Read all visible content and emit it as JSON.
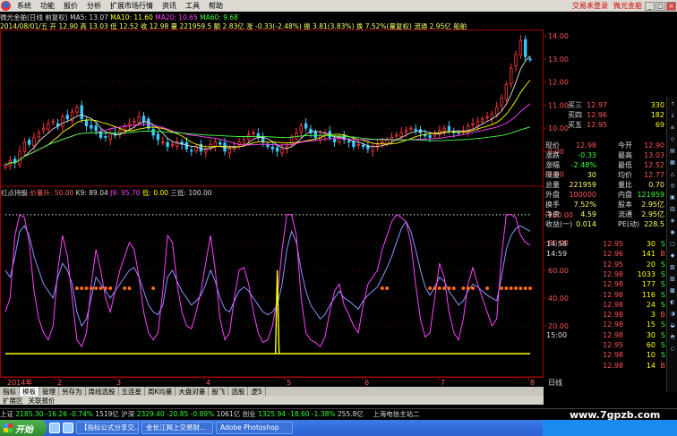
{
  "menu": {
    "items": [
      "系统",
      "功能",
      "报价",
      "分析",
      "扩展市场行情",
      "资讯",
      "工具",
      "帮助"
    ],
    "login_status": "交易未登录",
    "stock_name": "微光金舶"
  },
  "info": {
    "ma_line": [
      "微光金舶(日线 前复权)",
      "MA5: 13.07",
      "MA10: 11.60",
      "MA20: 10.65",
      "MA60: 9.68"
    ],
    "ma_colors": [
      "#dddddd",
      "#ffff00",
      "#ff44ff",
      "#44ff44"
    ],
    "day_line": "2014/08/01/五 开 12.90 高 13.03 低 12.52 收 12.98 量 221959.5 额 2.83亿 涨 -0.33(-2.48%) 振 3.81(3.83%) 换 7.52%(量复权) 流通 2.95亿 船舶"
  },
  "indicator": {
    "title": "红点持股",
    "values": [
      "价量升: 50.00",
      "K9: 89.04",
      "J9: 95.70",
      "低: 0.00",
      "三低: 100.00"
    ],
    "colors": [
      "#ff6666",
      "#dddddd",
      "#ff44ff",
      "#ffff00",
      "#dddddd"
    ]
  },
  "axis": {
    "price_ticks": [
      "14.00",
      "13.00",
      "12.00",
      "11.00",
      "10.00",
      "9.00",
      "8.00"
    ],
    "ind_ticks": [
      "100.00",
      "80.00",
      "60.00",
      "40.00",
      "20.00"
    ],
    "x_labels": [
      "2014年",
      "2",
      "3",
      "4",
      "5",
      "6",
      "7",
      "8"
    ],
    "x_right": "日线"
  },
  "chart_data": {
    "type": "candlestick",
    "ylim": [
      7.6,
      14.2
    ],
    "closes": [
      8.4,
      8.6,
      8.5,
      9.0,
      9.4,
      9.3,
      9.6,
      9.8,
      10.0,
      10.2,
      10.3,
      10.1,
      10.5,
      10.4,
      10.7,
      10.9,
      10.4,
      10.1,
      10.0,
      9.9,
      9.6,
      9.6,
      9.8,
      9.7,
      9.9,
      10.1,
      10.2,
      10.3,
      10.5,
      10.3,
      10.0,
      9.7,
      9.5,
      9.4,
      9.2,
      9.3,
      9.4,
      9.3,
      9.1,
      9.0,
      9.2,
      9.0,
      9.1,
      9.3,
      9.4,
      9.3,
      9.0,
      9.1,
      9.2,
      9.4,
      9.5,
      9.7,
      9.8,
      9.6,
      9.4,
      9.2,
      9.1,
      9.0,
      9.1,
      9.2,
      9.6,
      9.8,
      10.1,
      10.0,
      9.8,
      9.6,
      9.7,
      9.8,
      9.6,
      9.4,
      9.6,
      9.5,
      9.4,
      9.2,
      9.3,
      9.2,
      9.1,
      9.2,
      9.3,
      9.4,
      9.5,
      9.6,
      9.7,
      9.8,
      9.9,
      10.0,
      9.9,
      9.8,
      9.7,
      9.6,
      9.8,
      9.9,
      10.0,
      9.9,
      9.8,
      9.8,
      9.9,
      10.1,
      10.2,
      10.3,
      10.4,
      10.5,
      10.6,
      10.9,
      11.3,
      11.9,
      12.6,
      13.2,
      13.8,
      13.1,
      12.98
    ],
    "ind_series": [
      {
        "name": "K9",
        "color": "#8899ff",
        "values": [
          60,
          55,
          70,
          88,
          92,
          85,
          70,
          60,
          50,
          45,
          40,
          55,
          65,
          60,
          50,
          30,
          20,
          25,
          40,
          55,
          50,
          45,
          40,
          45,
          50,
          55,
          60,
          62,
          55,
          45,
          35,
          30,
          28,
          35,
          55,
          60,
          52,
          45,
          40,
          35,
          38,
          42,
          50,
          60,
          52,
          40,
          32,
          30,
          38,
          45,
          48,
          45,
          40,
          35,
          30,
          28,
          30,
          35,
          50,
          75,
          88,
          80,
          60,
          45,
          35,
          30,
          25,
          28,
          35,
          40,
          45,
          40,
          38,
          35,
          32,
          38,
          42,
          45,
          48,
          55,
          62,
          70,
          80,
          90,
          95,
          88,
          75,
          60,
          48,
          42,
          48,
          55,
          52,
          45,
          40,
          35,
          38,
          45,
          50,
          48,
          45,
          42,
          40,
          38,
          55,
          75,
          85,
          90,
          92,
          90,
          88
        ]
      },
      {
        "name": "J9",
        "color": "#ff44ff",
        "values": [
          30,
          40,
          85,
          100,
          98,
          80,
          45,
          25,
          15,
          10,
          20,
          60,
          85,
          70,
          40,
          10,
          5,
          15,
          50,
          75,
          60,
          40,
          30,
          45,
          60,
          70,
          80,
          75,
          55,
          30,
          15,
          10,
          15,
          45,
          85,
          80,
          50,
          30,
          20,
          18,
          30,
          45,
          65,
          85,
          60,
          25,
          10,
          15,
          40,
          60,
          62,
          50,
          30,
          15,
          8,
          10,
          20,
          40,
          75,
          100,
          100,
          85,
          40,
          15,
          10,
          8,
          5,
          12,
          30,
          45,
          50,
          35,
          28,
          20,
          15,
          35,
          50,
          55,
          60,
          75,
          85,
          95,
          100,
          98,
          95,
          80,
          50,
          25,
          12,
          15,
          40,
          65,
          55,
          30,
          15,
          10,
          25,
          50,
          62,
          50,
          40,
          30,
          20,
          25,
          70,
          100,
          100,
          98,
          85,
          80,
          78
        ]
      },
      {
        "name": "低",
        "color": "#ffff00",
        "values": [
          0,
          0,
          0,
          0,
          0,
          0,
          0,
          0,
          0,
          0,
          0,
          0,
          0,
          0,
          0,
          0,
          0,
          0,
          0,
          0,
          0,
          0,
          0,
          0,
          0,
          0,
          0,
          0,
          0,
          0,
          0,
          0,
          0,
          0,
          0,
          0,
          0,
          0,
          0,
          0,
          0,
          0,
          0,
          0,
          0,
          0,
          0,
          0,
          0,
          0,
          0,
          0,
          0,
          0,
          0,
          0,
          0,
          0,
          0,
          0,
          0,
          0,
          0,
          0,
          0,
          0,
          0,
          0,
          0,
          0,
          0,
          0,
          0,
          0,
          0,
          0,
          0,
          0,
          0,
          0,
          0,
          0,
          0,
          0,
          0,
          0,
          0,
          0,
          0,
          0,
          0,
          0,
          0,
          0,
          0,
          0,
          0,
          0,
          0,
          0,
          0,
          0,
          0,
          0,
          0,
          0,
          0,
          0,
          0,
          0,
          0
        ]
      },
      {
        "name": "三低",
        "color": "#dddddd",
        "values": [
          100
        ]
      }
    ],
    "signal_spike": {
      "index": 57,
      "value": 60
    },
    "red_dots_value": 47,
    "red_dot_indices": [
      15,
      16,
      17,
      18,
      19,
      20,
      21,
      22,
      25,
      26,
      31,
      79,
      80,
      89,
      90,
      91,
      92,
      93,
      94,
      96,
      97,
      98,
      101,
      104,
      105,
      106,
      107,
      108,
      109,
      110
    ]
  },
  "quote": {
    "book": [
      {
        "label": "买三",
        "price": "12.97",
        "vol": "330"
      },
      {
        "label": "买四",
        "price": "12.96",
        "vol": "182"
      },
      {
        "label": "买五",
        "price": "12.95",
        "vol": "69"
      }
    ],
    "stats": [
      [
        "现价",
        "12.98",
        "今开",
        "12.90"
      ],
      [
        "涨跌",
        "-0.33",
        "最高",
        "13.03"
      ],
      [
        "涨幅",
        "-2.48%",
        "最低",
        "12.52"
      ],
      [
        "现量",
        "30",
        "均价",
        "12.77"
      ],
      [
        "总量",
        "221959",
        "量比",
        "0.70"
      ],
      [
        "外盘",
        "100000",
        "内盘",
        "121959"
      ],
      [
        "换手",
        "7.52%",
        "股本",
        "2.95亿"
      ],
      [
        "净资",
        "4.59",
        "流通",
        "2.95亿"
      ],
      [
        "收益(一)",
        "0.014",
        "PE(动)",
        "228.5"
      ]
    ],
    "ticks": [
      [
        "14:58",
        "12.95",
        "30",
        "S"
      ],
      [
        "14:59",
        "12.96",
        "141",
        "B"
      ],
      [
        "",
        "12.95",
        "20",
        "S"
      ],
      [
        "",
        "12.98",
        "1033",
        "S"
      ],
      [
        "",
        "12.98",
        "177",
        "S"
      ],
      [
        "",
        "12.98",
        "116",
        "S"
      ],
      [
        "",
        "12.98",
        "24",
        "S"
      ],
      [
        "",
        "12.98",
        "3",
        "B"
      ],
      [
        "",
        "12.98",
        "15",
        "S"
      ],
      [
        "15:00",
        "12.98",
        "30",
        "S"
      ],
      [
        "",
        "12.95",
        "60",
        "S"
      ],
      [
        "",
        "12.98",
        "10",
        "S"
      ],
      [
        "",
        "12.98",
        "14",
        "B"
      ]
    ]
  },
  "tabs": {
    "row1": [
      "指标",
      "模板",
      "管理",
      "另存为",
      "周线选股",
      "五连星",
      "周K均量",
      "大盘对量",
      "股飞",
      "选股",
      "逻5"
    ],
    "row2": [
      "扩展区",
      "关联报价"
    ]
  },
  "index_bar": [
    {
      "name": "上证",
      "value": "2185.30",
      "chg": "-16.26",
      "pct": "-0.74%",
      "amt": "1519亿"
    },
    {
      "name": "沪深",
      "value": "2329.40",
      "chg": "-20.85",
      "pct": "-0.89%",
      "amt": "1061亿"
    },
    {
      "name": "创业",
      "value": "1325.94",
      "chg": "-18.60",
      "pct": "-1.38%",
      "amt": "255.8亿"
    }
  ],
  "index_msg": "上海电信主站二",
  "taskbar": {
    "start": "开始",
    "tasks": [
      "【指标公式分享交...",
      "金长江网上交易财...",
      "Adobe Photoshop"
    ]
  },
  "watermark": "www.7gpzb.com"
}
